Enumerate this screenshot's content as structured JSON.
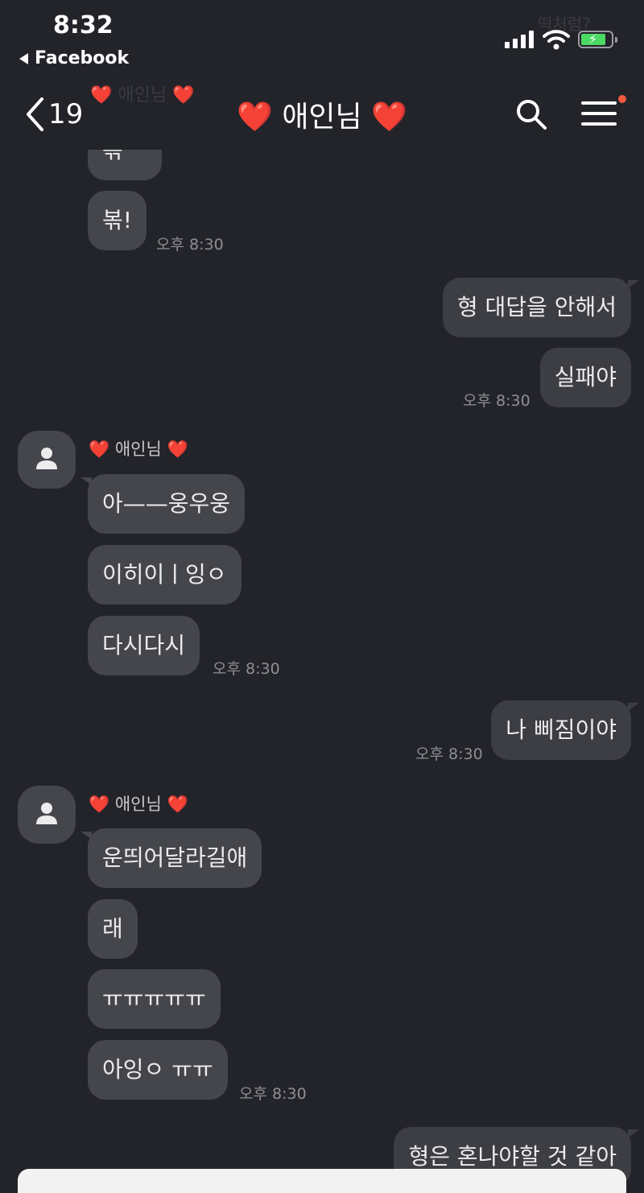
{
  "status_bar": {
    "time": "8:32",
    "back_app": "Facebook"
  },
  "ghost_text": {
    "top_right": "떡처럼? ",
    "under_header": "❤️ 애인님 ❤️"
  },
  "header": {
    "back_count": "19",
    "title": "❤️ 애인님 ❤️"
  },
  "messages": {
    "m0": "볶!",
    "m0_cut": "볶",
    "t0": "오후 8:30",
    "m1": "형 대답을 안해서",
    "m2": "실패야",
    "t1": "오후 8:30",
    "sender1": "❤️ 애인님 ❤️",
    "m3": "아——웅우웅",
    "m4": "이히이ㅣ잉ㅇ",
    "m5": "다시다시",
    "t2": "오후 8:30",
    "m6": "나 삐짐이야",
    "t3": "오후 8:30",
    "sender2": "❤️ 애인님 ❤️",
    "m7": "운띄어달라길애",
    "m8": "래",
    "m9": "ㅠㅠㅠㅠㅠ",
    "m10": "아잉ㅇ ㅠㅠ",
    "t4": "오후 8:30",
    "m11": "형은 혼나야할 것 같아"
  },
  "icons": [
    "back-chevron-icon",
    "search-icon",
    "menu-icon",
    "avatar-person-icon",
    "wifi-icon",
    "battery-charging-icon"
  ]
}
